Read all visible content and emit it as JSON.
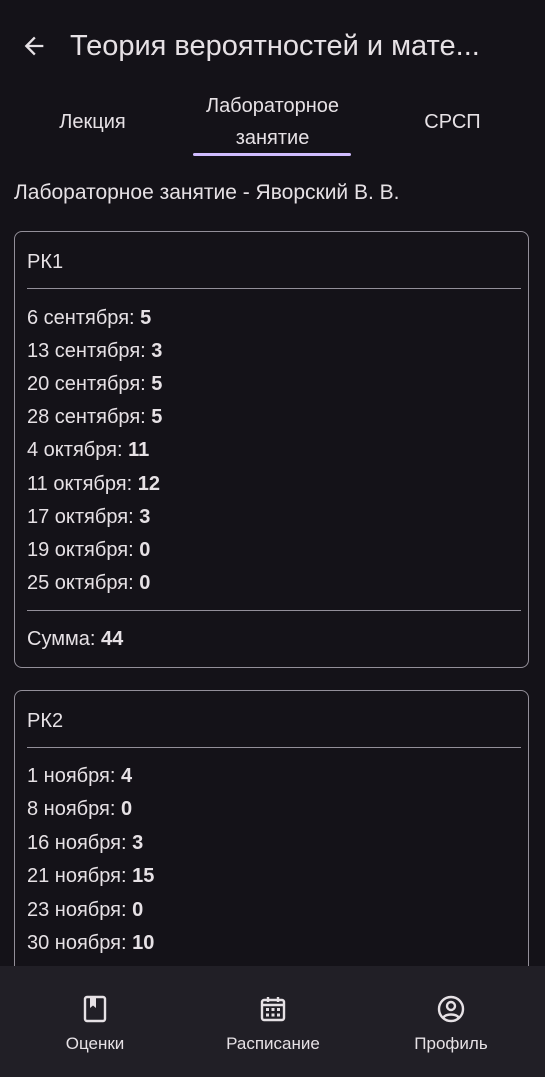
{
  "appbar": {
    "title": "Теория вероятностей и мате...",
    "back_icon": "arrow-back-icon"
  },
  "tabs": [
    {
      "label": "Лекция",
      "selected": false
    },
    {
      "label": "Лабораторное занятие",
      "selected": true
    },
    {
      "label": "СРСП",
      "selected": false
    }
  ],
  "subtitle": "Лабораторное занятие - Яворский В. В.",
  "cards": [
    {
      "title": "РК1",
      "rows": [
        {
          "date": "6 сентября: ",
          "score": "5"
        },
        {
          "date": "13 сентября: ",
          "score": "3"
        },
        {
          "date": "20 сентября: ",
          "score": "5"
        },
        {
          "date": "28 сентября: ",
          "score": "5"
        },
        {
          "date": "4 октября: ",
          "score": "11"
        },
        {
          "date": "11 октября: ",
          "score": "12"
        },
        {
          "date": "17 октября: ",
          "score": "3"
        },
        {
          "date": "19 октября: ",
          "score": "0"
        },
        {
          "date": "25 октября: ",
          "score": "0"
        }
      ],
      "sum_label": "Сумма: ",
      "sum_value": "44"
    },
    {
      "title": "РК2",
      "rows": [
        {
          "date": "1 ноября: ",
          "score": "4"
        },
        {
          "date": "8 ноября: ",
          "score": "0"
        },
        {
          "date": "16 ноября: ",
          "score": "3"
        },
        {
          "date": "21 ноября: ",
          "score": "15"
        },
        {
          "date": "23 ноября: ",
          "score": "0"
        },
        {
          "date": "30 ноября: ",
          "score": "10"
        }
      ]
    }
  ],
  "bottom_nav": [
    {
      "label": "Оценки",
      "icon": "book-icon"
    },
    {
      "label": "Расписание",
      "icon": "calendar-icon"
    },
    {
      "label": "Профиль",
      "icon": "account-circle-icon"
    }
  ],
  "colors": {
    "background": "#141218",
    "surface": "#211f26",
    "text": "#e6e1e5",
    "outline": "#938f99",
    "accent": "#d0bcff"
  }
}
